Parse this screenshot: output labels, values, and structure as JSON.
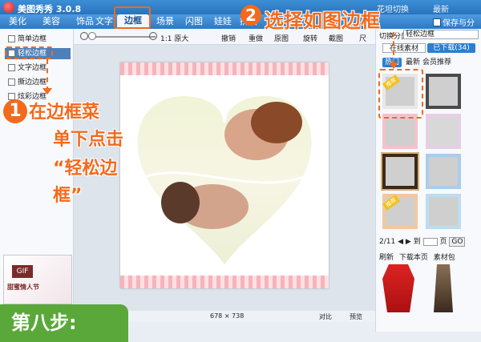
{
  "app": {
    "title": "美图秀秀 3.0.8",
    "title_right": "花坦切换",
    "title_right2": "最新"
  },
  "tabs": [
    {
      "label": "美化"
    },
    {
      "label": "美容"
    },
    {
      "label": "饰品"
    },
    {
      "label": "文字"
    },
    {
      "label": "边框"
    },
    {
      "label": "场景"
    },
    {
      "label": "闪图"
    },
    {
      "label": "娃娃"
    },
    {
      "label": "拼图"
    }
  ],
  "save_share": "保存与分享",
  "toolbar": {
    "orig_size": "1:1 原大",
    "undo": "撤销",
    "redo": "重做",
    "original": "原图",
    "rotate": "旋转",
    "crop": "截图",
    "size": "尺"
  },
  "left_panel": {
    "items": [
      {
        "label": "简单边框"
      },
      {
        "label": "轻松边框"
      },
      {
        "label": "文字边框"
      },
      {
        "label": "撕边边框"
      },
      {
        "label": "炫彩边框"
      }
    ]
  },
  "right_panel": {
    "category_label": "切换分类",
    "category_value": "轻松边框",
    "tab_online": "在线素材",
    "tab_downloaded": "已下载(34)",
    "subtabs": [
      "热门",
      "最新",
      "会员推荐"
    ],
    "ribbon_label": "推荐",
    "pager": {
      "current": "2/11",
      "page_label": "到",
      "page_unit": "页",
      "go": "GO"
    },
    "actions": [
      "刷新",
      "下载本页",
      "素材包"
    ]
  },
  "canvas": {
    "dimensions": "678 × 738",
    "compare": "对比",
    "preview": "预览"
  },
  "left_ad": {
    "gif": "GIF",
    "text": "甜蜜情人节"
  },
  "annotations": {
    "step1_number": "1",
    "step1_lines": [
      "在边框菜",
      "单下点击",
      "“轻松边",
      "框”"
    ],
    "step2_number": "2",
    "step2_text": "选择如图边框",
    "step8": "第八步:"
  },
  "colors": {
    "accent": "#f26a1d",
    "titlebar": "#2a73bd",
    "step_badge": "#5aa83a"
  }
}
